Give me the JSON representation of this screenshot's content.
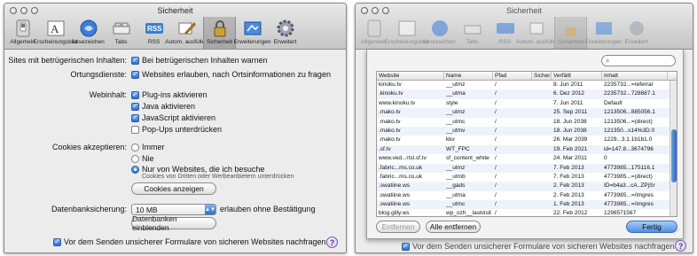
{
  "colors": {
    "accent": "#2f6fd0",
    "selected_tab_bg": "#a6a6a6",
    "window_bg": "#ececec"
  },
  "toolbar_items": [
    {
      "icon": "general-switch-icon",
      "label": "Allgemein"
    },
    {
      "icon": "appearance-a-icon",
      "label": "Erscheinungsbild"
    },
    {
      "icon": "bookmarks-book-icon",
      "label": "Lesezeichen"
    },
    {
      "icon": "tabs-icon",
      "label": "Tabs"
    },
    {
      "icon": "rss-icon",
      "label": "RSS"
    },
    {
      "icon": "autofill-pencil-icon",
      "label": "Autom. ausfüllen"
    },
    {
      "icon": "security-lock-icon",
      "label": "Sicherheit"
    },
    {
      "icon": "extensions-icon",
      "label": "Erweiterungen"
    },
    {
      "icon": "advanced-gear-icon",
      "label": "Erweitert"
    }
  ],
  "window1": {
    "title": "Sicherheit",
    "fraud_label": "Sites mit betrügerischen Inhalten:",
    "fraud_option": "Bei betrügerischen Inhalten warnen",
    "location_label": "Ortungsdienste:",
    "location_option": "Websites erlauben, nach Ortsinformationen zu fragen",
    "webcontent_label": "Webinhalt:",
    "webcontent_options": [
      {
        "label": "Plug-ins aktivieren",
        "checked": true
      },
      {
        "label": "Java aktivieren",
        "checked": true
      },
      {
        "label": "JavaScript aktivieren",
        "checked": true
      },
      {
        "label": "Pop-Ups unterdrücken",
        "checked": false
      }
    ],
    "cookies_label": "Cookies akzeptieren:",
    "cookies_options": [
      {
        "label": "Immer",
        "selected": false
      },
      {
        "label": "Nie",
        "selected": false
      },
      {
        "label": "Nur von Websites, die ich besuche",
        "selected": true
      }
    ],
    "cookies_note": "Cookies von Dritten oder Werbeanbietern unterdrücken",
    "cookies_button": "Cookies anzeigen",
    "db_label": "Datenbanksicherung:",
    "db_value": "10 MB",
    "db_suffix": "erlauben ohne Bestätigung",
    "db_button": "Datenbanken einblenden",
    "form_warn": "Vor dem Senden unsicherer Formulare von sicheren Websites nachfragen",
    "help": "?"
  },
  "window2": {
    "title": "Sicherheit",
    "search_glass": "⌕",
    "columns": [
      "Website",
      "Name",
      "Pfad",
      "Sicher",
      "Verfällt",
      "Inhalt"
    ],
    "rows": [
      [
        "kinoku.tv",
        "__utmz",
        "/",
        "",
        "8. Jun 2011",
        "2235732...=referral"
      ],
      [
        ".kinoku.tv",
        "__utma",
        "/",
        "",
        "6. Dez 2012",
        "2235732...728687.1"
      ],
      [
        "www.kinoku.tv",
        "style",
        "/",
        "",
        "7. Jun 2011",
        "Default"
      ],
      [
        ".mako.tv",
        "__utmz",
        "/",
        "",
        "25. Sep 2011",
        "1213506...885056.1"
      ],
      [
        ".mako.tv",
        "__utmc",
        "/",
        "",
        "18. Jun 2038",
        "1213506...=(direct)"
      ],
      [
        ".mako.tv",
        "__utmv",
        "/",
        "",
        "18. Jun 2038",
        "121350...s14%3D.0"
      ],
      [
        ".mako.tv",
        "kkv",
        "/",
        "",
        "26. Mar 2039",
        "1229...3.1.1b1b1.0"
      ],
      [
        ".sf.tv",
        "WT_FPC",
        "/",
        "",
        "19. Feb 2021",
        "id=147.8...3674796"
      ],
      [
        "www.ved...rtsl.sf.tv",
        "sf_content_white",
        "/",
        "",
        "24. Mar 2011",
        "0"
      ],
      [
        ".fabric...ms.co.uk",
        "__utmz",
        "/",
        "",
        "7. Feb 2013",
        "4773985...175116.1"
      ],
      [
        ".fabric...ms.co.uk",
        "__utmb",
        "/",
        "",
        "7. Feb 2013",
        "4773985...=(direct)"
      ],
      [
        ".swatiine.ws",
        "__gads",
        "/",
        "",
        "2. Feb 2013",
        "ID=b4a3...cA..ZPjSr"
      ],
      [
        ".swatiine.ws",
        "__utma",
        "/",
        "",
        "2. Feb 2013",
        "4773985...=/imgres"
      ],
      [
        ".swatiine.ws",
        "__utmc",
        "/",
        "",
        "1. Feb 2013",
        "4773985...=/imgres"
      ],
      [
        "blog.gilly.ws",
        "wp_ozh__lastvisit",
        "/",
        "",
        "22. Feb 2012",
        "1298571567"
      ],
      [
        "blog.gilly.ws",
        "wp_ozh_wsa_visits",
        "/",
        "",
        "22. Feb 2012",
        "1"
      ],
      [
        "blog.gilly.ws",
        "__jsuid",
        "/",
        "",
        "15. Feb 2011",
        "1350240...sb6b5dcb"
      ]
    ],
    "remove_button": "Entfernen",
    "remove_all_button": "Alle entfernen",
    "done_button": "Fertig",
    "form_warn": "Vor dem Senden unsicherer Formulare von sicheren Websites nachfragen"
  }
}
